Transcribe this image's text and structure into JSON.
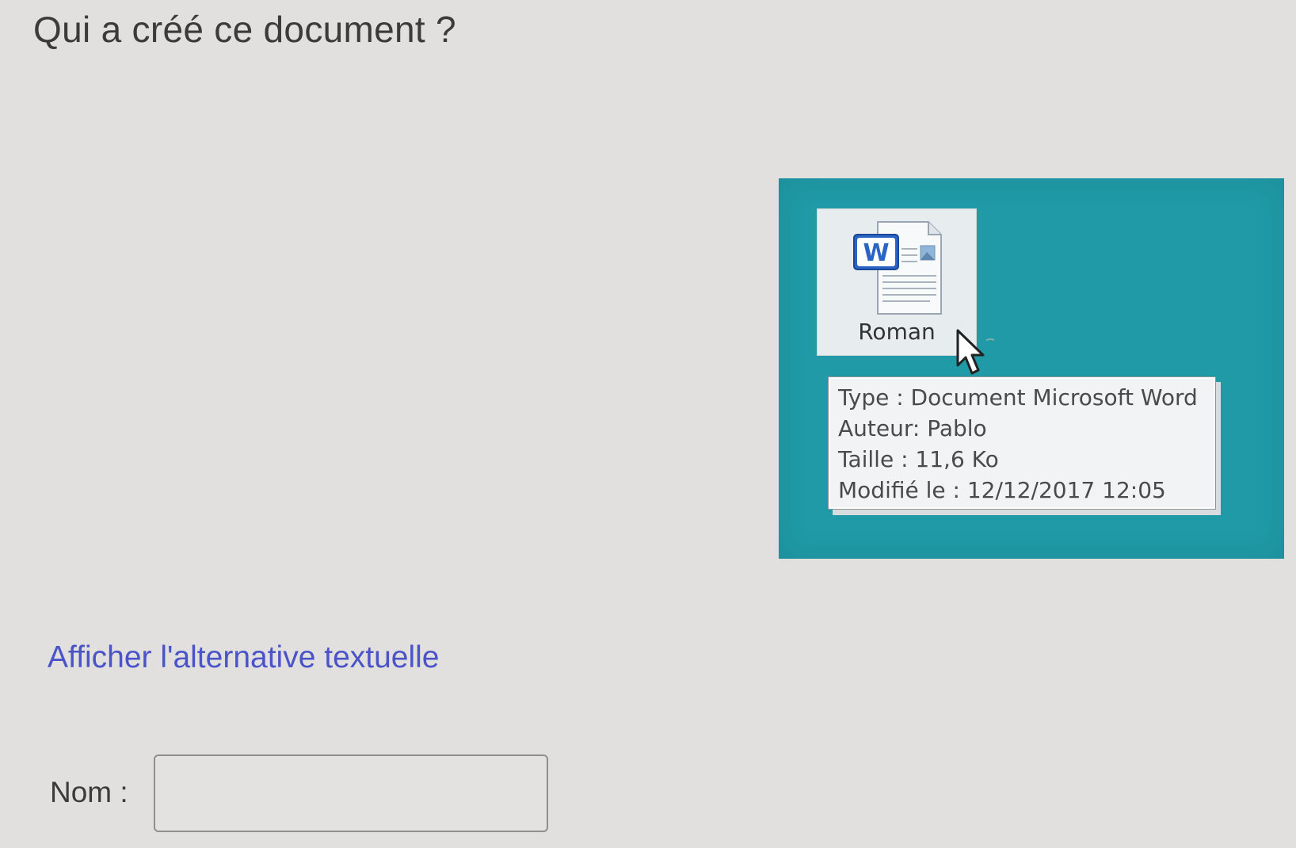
{
  "question": {
    "title": "Qui a créé ce document ?"
  },
  "screenshot": {
    "background_color": "#1f9aa6",
    "file": {
      "icon": "word-document-icon",
      "name": "Roman"
    },
    "tooltip": {
      "lines": [
        "Type : Document Microsoft Word",
        "Auteur: Pablo",
        "Taille : 11,6 Ko",
        "Modifié le : 12/12/2017 12:05"
      ]
    }
  },
  "alt_text_link": {
    "label": "Afficher l'alternative textuelle",
    "color": "#4b53c9"
  },
  "form": {
    "name_label": "Nom :",
    "name_value": "",
    "name_placeholder": ""
  }
}
